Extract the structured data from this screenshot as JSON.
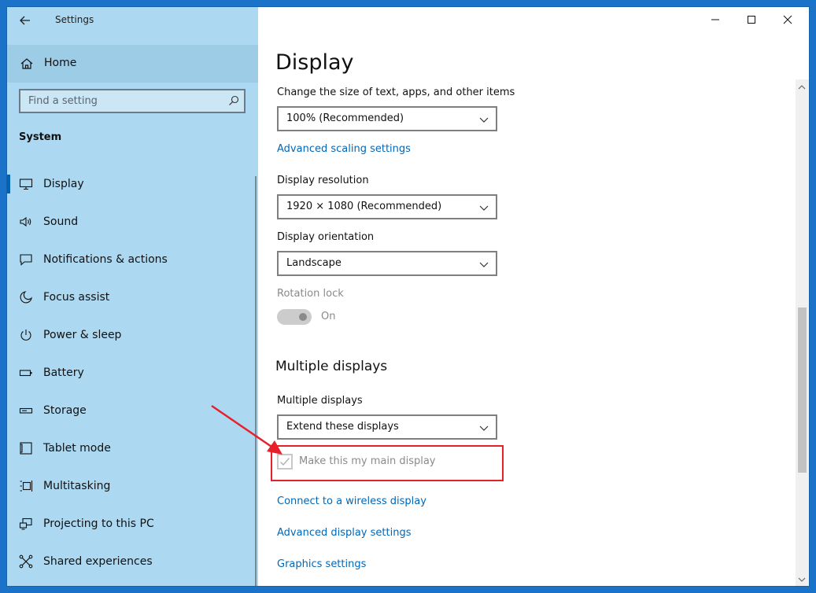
{
  "window": {
    "title": "Settings"
  },
  "sidebar": {
    "home_label": "Home",
    "search_placeholder": "Find a setting",
    "section_title": "System",
    "items": [
      {
        "label": "Display",
        "icon": "monitor-icon",
        "active": true
      },
      {
        "label": "Sound",
        "icon": "speaker-icon"
      },
      {
        "label": "Notifications & actions",
        "icon": "notification-icon"
      },
      {
        "label": "Focus assist",
        "icon": "moon-icon"
      },
      {
        "label": "Power & sleep",
        "icon": "power-icon"
      },
      {
        "label": "Battery",
        "icon": "battery-icon"
      },
      {
        "label": "Storage",
        "icon": "storage-icon"
      },
      {
        "label": "Tablet mode",
        "icon": "tablet-icon"
      },
      {
        "label": "Multitasking",
        "icon": "multitasking-icon"
      },
      {
        "label": "Projecting to this PC",
        "icon": "projecting-icon"
      },
      {
        "label": "Shared experiences",
        "icon": "shared-experiences-icon"
      }
    ]
  },
  "main": {
    "page_title": "Display",
    "scale": {
      "label": "Change the size of text, apps, and other items",
      "value": "100% (Recommended)"
    },
    "advanced_scaling_link": "Advanced scaling settings",
    "resolution": {
      "label": "Display resolution",
      "value": "1920 × 1080 (Recommended)"
    },
    "orientation": {
      "label": "Display orientation",
      "value": "Landscape"
    },
    "rotation_lock": {
      "label": "Rotation lock",
      "state": "On"
    },
    "multiple_displays_heading": "Multiple displays",
    "multiple_displays": {
      "label": "Multiple displays",
      "value": "Extend these displays"
    },
    "main_display_checkbox": {
      "label": "Make this my main display",
      "checked": true
    },
    "links": {
      "wireless": "Connect to a wireless display",
      "advanced_display": "Advanced display settings",
      "graphics": "Graphics settings"
    }
  },
  "colors": {
    "accent": "#0067b8",
    "sidebar_bg": "#acd9f1",
    "highlight": "#e8202a"
  }
}
